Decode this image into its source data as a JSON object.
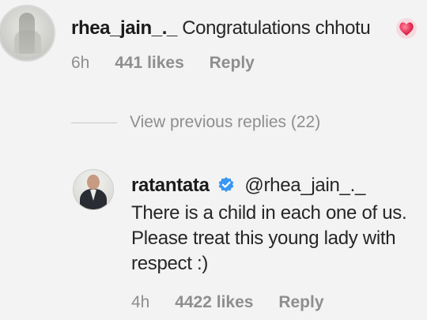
{
  "comment": {
    "username": "rhea_jain_._",
    "text": "Congratulations chhotu",
    "emoji": "heart-emoji",
    "time": "6h",
    "likes": "441 likes",
    "reply_label": "Reply"
  },
  "thread": {
    "view_previous": "View previous replies (22)"
  },
  "reply": {
    "username": "ratantata",
    "mention": "@rhea_jain_._",
    "text": "There is a child in each one of us. Please treat this young lady with respect :)",
    "time": "4h",
    "likes": "4422 likes",
    "reply_label": "Reply"
  },
  "colors": {
    "verified": "#3897f0",
    "heart": "#e8335a",
    "muted": "#8e8e8e"
  }
}
